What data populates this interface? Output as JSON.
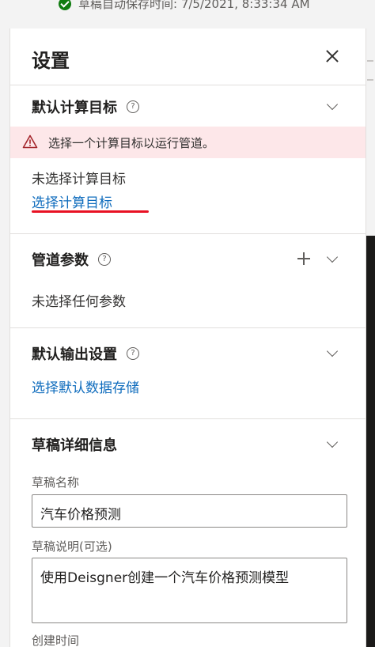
{
  "autosave": {
    "text": "草稿自动保存时间: 7/5/2021, 8:33:34 AM"
  },
  "panel": {
    "title": "设置",
    "compute": {
      "title": "默认计算目标",
      "warning": "选择一个计算目标以运行管道。",
      "status": "未选择计算目标",
      "link": "选择计算目标"
    },
    "pipeline_params": {
      "title": "管道参数",
      "status": "未选择任何参数"
    },
    "output": {
      "title": "默认输出设置",
      "link": "选择默认数据存储"
    },
    "draft": {
      "title": "草稿详细信息",
      "name_label": "草稿名称",
      "name_value": "汽车价格预测",
      "desc_label": "草稿说明(可选)",
      "desc_value": "使用Deisgner创建一个汽车价格预测模型",
      "created_label": "创建时间"
    }
  },
  "icons": {
    "close": "close-icon",
    "help": "help-icon",
    "chevron": "chevron-down-icon",
    "add": "plus-icon",
    "warning": "warning-icon",
    "check": "check-circle-icon"
  },
  "colors": {
    "link": "#0f6cbd",
    "warning_bg": "#fde7e9",
    "warning_icon": "#a4262c",
    "annotation": "#e81123",
    "success": "#107c10"
  }
}
